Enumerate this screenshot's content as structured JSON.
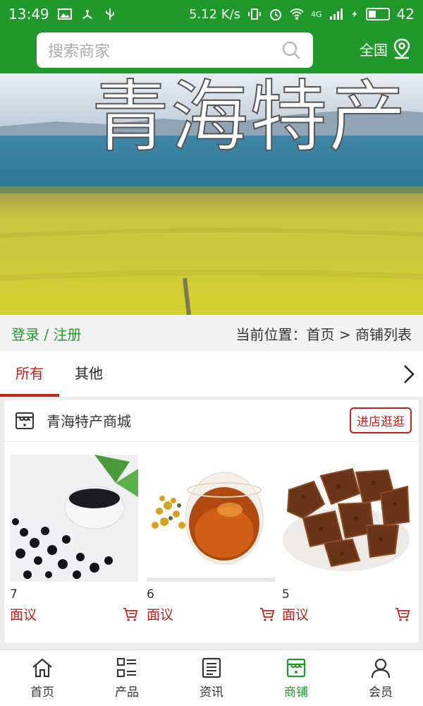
{
  "status_bar": {
    "time": "13:49",
    "speed": "5.12 K/s",
    "network": "4G",
    "battery": "42",
    "battery_level": 0.42
  },
  "header": {
    "search_placeholder": "搜索商家",
    "region_label": "全国",
    "search_icon": "search-icon",
    "location_icon": "location-pin-icon"
  },
  "banner": {
    "title": "青海特产"
  },
  "crumbbar": {
    "login_label": "登录 / 注册",
    "breadcrumb": "当前位置：首页 > 商铺列表"
  },
  "tabs": [
    {
      "label": "所有",
      "active": true
    },
    {
      "label": "其他",
      "active": false
    }
  ],
  "shop": {
    "name": "青海特产商城",
    "visit_label": "进店逛逛",
    "products": [
      {
        "num": "7",
        "price": "面议",
        "image": "black-goji-berries"
      },
      {
        "num": "6",
        "price": "面议",
        "image": "chrysanthemum-tea"
      },
      {
        "num": "5",
        "price": "面议",
        "image": "dried-yak-meat"
      }
    ]
  },
  "bottom_nav": [
    {
      "label": "首页",
      "icon": "home-icon",
      "active": false
    },
    {
      "label": "产品",
      "icon": "grid-list-icon",
      "active": false
    },
    {
      "label": "资讯",
      "icon": "news-icon",
      "active": false
    },
    {
      "label": "商铺",
      "icon": "store-icon",
      "active": true
    },
    {
      "label": "会员",
      "icon": "user-icon",
      "active": false
    }
  ],
  "colors": {
    "brand_green": "#1f9a2a",
    "accent_red": "#c0201e"
  }
}
